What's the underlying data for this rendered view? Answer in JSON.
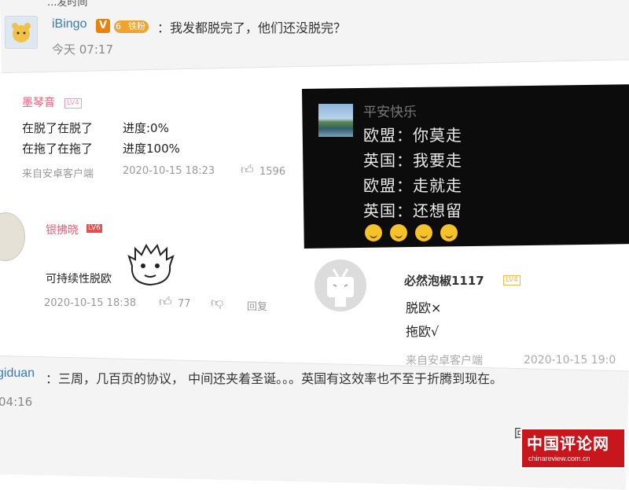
{
  "top_post": {
    "cut_text": "...发时间",
    "username": "iBingo",
    "v_badge": "V",
    "fan_badge_level": "6",
    "fan_badge_label": "铁粉",
    "comment": "：我发都脱完了，他们还没脱完？",
    "time": "今天 07:17"
  },
  "comment1": {
    "username": "墨琴音",
    "level": "LV4",
    "line1_a": "在脱了在脱了",
    "line1_b": "进度:0%",
    "line2_a": "在拖了在拖了",
    "line2_b": "进度100%",
    "source": "来自安卓客户端",
    "date": "2020-10-15 18:23",
    "likes": "1596"
  },
  "dark_image": {
    "username": "平安快乐",
    "lines": [
      "欧盟：你莫走",
      "英国：我要走",
      "欧盟：走就走",
      "英国：还想留"
    ]
  },
  "comment2": {
    "username": "银拂晓",
    "level": "LV6",
    "text": "可持续性脱欧",
    "date": "2020-10-15 18:38",
    "likes": "77",
    "reply": "回复"
  },
  "comment3": {
    "username": "必然泡椒1117",
    "level": "LV4",
    "line1": "脱欧×",
    "line2": "拖欧√",
    "source": "来自安卓客户端",
    "date": "2020-10-15 19:0"
  },
  "bottom_post": {
    "username": "giduan",
    "text": "：三周，几百页的协议， 中间还夹着圣诞。。。英国有这效率也不至于折腾到现在。",
    "time": "04:16",
    "cut_text": "回"
  },
  "watermark": {
    "title": "中国评论网",
    "url": "chinareview.com.cn"
  }
}
